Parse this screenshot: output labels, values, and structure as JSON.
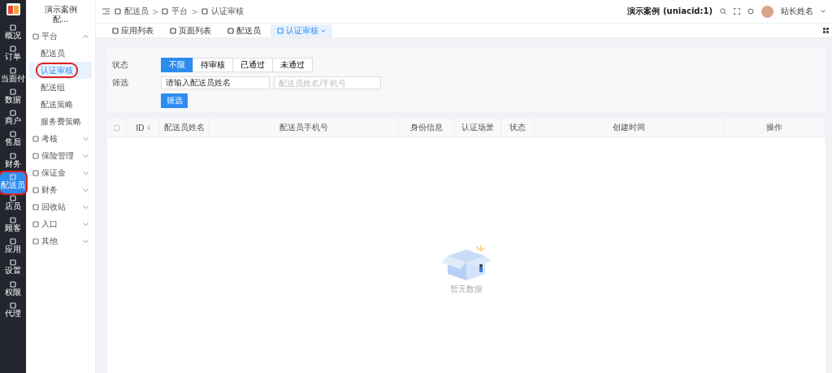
{
  "rail": [
    {
      "label": "概况",
      "selected": false,
      "highlighted": false
    },
    {
      "label": "订单",
      "selected": false,
      "highlighted": false
    },
    {
      "label": "当面付",
      "selected": false,
      "highlighted": false
    },
    {
      "label": "数据",
      "selected": false,
      "highlighted": false
    },
    {
      "label": "商户",
      "selected": false,
      "highlighted": false
    },
    {
      "label": "售后",
      "selected": false,
      "highlighted": false
    },
    {
      "label": "财务",
      "selected": false,
      "highlighted": false
    },
    {
      "label": "配送员",
      "selected": true,
      "highlighted": true
    },
    {
      "label": "店员",
      "selected": false,
      "highlighted": false
    },
    {
      "label": "顾客",
      "selected": false,
      "highlighted": false
    },
    {
      "label": "应用",
      "selected": false,
      "highlighted": false
    },
    {
      "label": "设置",
      "selected": false,
      "highlighted": false
    },
    {
      "label": "权限",
      "selected": false,
      "highlighted": false
    },
    {
      "label": "代理",
      "selected": false,
      "highlighted": false
    }
  ],
  "sidebar": {
    "title": "演示案例配...",
    "items": [
      {
        "label": "平台",
        "expanded": true,
        "children": [
          {
            "label": "配送员",
            "selected": false,
            "highlighted": false
          },
          {
            "label": "认证审核",
            "selected": true,
            "highlighted": true
          },
          {
            "label": "配送组",
            "selected": false,
            "highlighted": false
          },
          {
            "label": "配送策略",
            "selected": false,
            "highlighted": false
          },
          {
            "label": "服务费策略",
            "selected": false,
            "highlighted": false
          }
        ]
      },
      {
        "label": "考核",
        "expanded": false
      },
      {
        "label": "保险管理",
        "expanded": false
      },
      {
        "label": "保证金",
        "expanded": false
      },
      {
        "label": "财务",
        "expanded": false
      },
      {
        "label": "回收站",
        "expanded": false
      },
      {
        "label": "入口",
        "expanded": false
      },
      {
        "label": "其他",
        "expanded": false
      }
    ]
  },
  "breadcrumb": [
    {
      "label": "配送员"
    },
    {
      "separator": ">",
      "label": "平台"
    },
    {
      "separator": ">",
      "label": "认证审核"
    }
  ],
  "header": {
    "shop": "演示案例 (uniacid:1)",
    "user": "站长姓名"
  },
  "tabs": [
    {
      "label": "应用列表",
      "selected": false
    },
    {
      "label": "页面列表",
      "selected": false
    },
    {
      "label": "配送员",
      "selected": false
    },
    {
      "label": "认证审核",
      "selected": true
    }
  ],
  "filter": {
    "status_label": "状态",
    "status_options": [
      {
        "label": "不限",
        "selected": true
      },
      {
        "label": "待审核",
        "selected": false
      },
      {
        "label": "已通过",
        "selected": false
      },
      {
        "label": "未通过",
        "selected": false
      }
    ],
    "filter_label": "筛选",
    "field_value": "请输入配送员姓名",
    "search_placeholder": "配送员姓名/手机号",
    "button": "筛选"
  },
  "table": {
    "select_all_checked": false,
    "columns": [
      "ID",
      "配送员姓名",
      "配送员手机号",
      "身份信息",
      "认证场景",
      "状态",
      "创建时间",
      "操作"
    ],
    "empty_text": "暂无数据"
  }
}
